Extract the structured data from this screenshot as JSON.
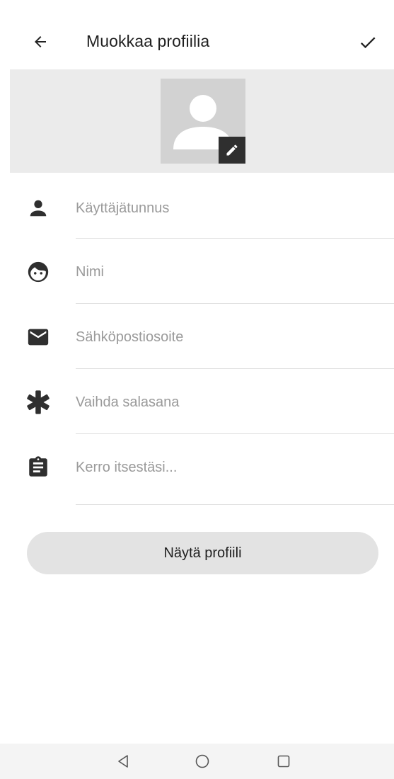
{
  "appbar": {
    "title": "Muokkaa profiilia",
    "back_icon": "arrow-left-icon",
    "confirm_icon": "check-icon"
  },
  "avatar": {
    "placeholder_icon": "person-placeholder-icon",
    "edit_icon": "pencil-icon"
  },
  "form": {
    "fields": [
      {
        "icon": "person-icon",
        "placeholder": "Käyttäjätunnus",
        "value": ""
      },
      {
        "icon": "face-icon",
        "placeholder": "Nimi",
        "value": ""
      },
      {
        "icon": "mail-icon",
        "placeholder": "Sähköpostiosoite",
        "value": ""
      },
      {
        "icon": "asterisk-icon",
        "placeholder": "Vaihda salasana",
        "value": ""
      },
      {
        "icon": "clipboard-icon",
        "placeholder": "Kerro itsestäsi...",
        "value": ""
      }
    ]
  },
  "show_profile_button": {
    "label": "Näytä profiili"
  },
  "navbar": {
    "back_icon": "triangle-back-icon",
    "home_icon": "circle-home-icon",
    "recents_icon": "square-recents-icon"
  },
  "colors": {
    "icon": "#2f2f2f",
    "placeholder_text": "#9a9a9a",
    "avatar_band": "#ebebeb",
    "button_bg": "#e3e3e3"
  }
}
